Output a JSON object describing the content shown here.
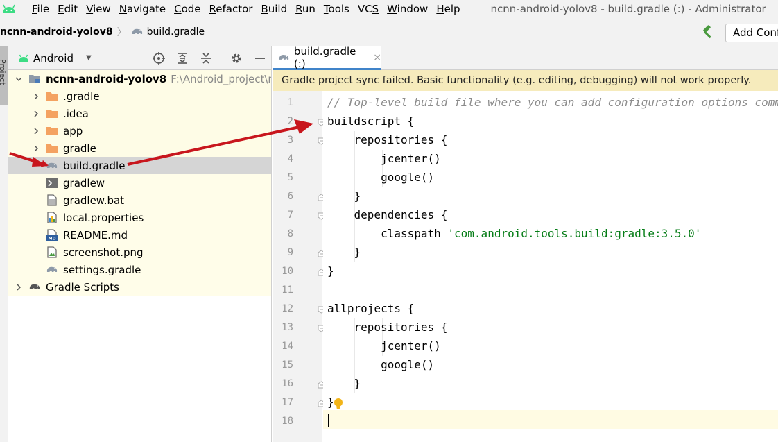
{
  "menubar": {
    "items": [
      {
        "label": "File",
        "u": "F",
        "rest": "ile"
      },
      {
        "label": "Edit",
        "u": "E",
        "rest": "dit"
      },
      {
        "label": "View",
        "u": "V",
        "rest": "iew"
      },
      {
        "label": "Navigate",
        "u": "N",
        "rest": "avigate"
      },
      {
        "label": "Code",
        "u": "C",
        "rest": "ode"
      },
      {
        "label": "Refactor",
        "u": "R",
        "rest": "efactor"
      },
      {
        "label": "Build",
        "u": "B",
        "rest": "uild"
      },
      {
        "label": "Run",
        "u": "R",
        "rest": "un"
      },
      {
        "label": "Tools",
        "u": "T",
        "rest": "ools"
      },
      {
        "label": "VCS",
        "u": "S",
        "pre": "VC",
        "rest": ""
      },
      {
        "label": "Window",
        "u": "W",
        "rest": "indow"
      },
      {
        "label": "Help",
        "u": "H",
        "rest": "elp"
      }
    ],
    "window_title": "ncnn-android-yolov8 - build.gradle (:) - Administrator"
  },
  "navbar": {
    "project": "ncnn-android-yolov8",
    "separator": "〉",
    "file": "build.gradle",
    "run_config_label": "Add Conf"
  },
  "side_strip": {
    "label": "Project"
  },
  "panel": {
    "view_label": "Android",
    "tree": [
      {
        "label": "ncnn-android-yolov8",
        "path": "F:\\Android_project\\ncnn-a",
        "icon": "module-folder-icon",
        "expanded": true,
        "bold": true,
        "level": 0
      },
      {
        "label": ".gradle",
        "icon": "folder-icon",
        "expandable": true,
        "level": 1
      },
      {
        "label": ".idea",
        "icon": "folder-icon",
        "expandable": true,
        "level": 1
      },
      {
        "label": "app",
        "icon": "folder-icon",
        "expandable": true,
        "level": 1
      },
      {
        "label": "gradle",
        "icon": "folder-icon",
        "expandable": true,
        "level": 1
      },
      {
        "label": "build.gradle",
        "icon": "gradle-elephant-icon",
        "selected": true,
        "level": 1
      },
      {
        "label": "gradlew",
        "icon": "terminal-file-icon",
        "level": 1
      },
      {
        "label": "gradlew.bat",
        "icon": "text-file-icon",
        "level": 1
      },
      {
        "label": "local.properties",
        "icon": "properties-file-icon",
        "level": 1
      },
      {
        "label": "README.md",
        "icon": "markdown-file-icon",
        "level": 1
      },
      {
        "label": "screenshot.png",
        "icon": "image-file-icon",
        "level": 1
      },
      {
        "label": "settings.gradle",
        "icon": "gradle-elephant-icon",
        "level": 1
      },
      {
        "label": "Gradle Scripts",
        "icon": "gradle-elephant-dark-icon",
        "expandable": true,
        "level": 0
      }
    ]
  },
  "editor": {
    "tab_label": "build.gradle (:)",
    "tab_close": "×",
    "warning": "Gradle project sync failed. Basic functionality (e.g. editing, debugging) will not work properly.",
    "line_numbers": [
      "1",
      "2",
      "3",
      "4",
      "5",
      "6",
      "7",
      "8",
      "9",
      "10",
      "11",
      "12",
      "13",
      "14",
      "15",
      "16",
      "17",
      "18"
    ],
    "lines": [
      {
        "indent": "",
        "comment": "// Top-level build file where you can add configuration options common to all sub-projects/modules."
      },
      {
        "indent": "",
        "code": "buildscript {"
      },
      {
        "indent": "    ",
        "code": "repositories {"
      },
      {
        "indent": "        ",
        "code": "jcenter()"
      },
      {
        "indent": "        ",
        "code": "google()"
      },
      {
        "indent": "    ",
        "code": "}"
      },
      {
        "indent": "    ",
        "code": "dependencies {"
      },
      {
        "indent": "        ",
        "code": "classpath ",
        "string": "'com.android.tools.build:gradle:3.5.0'"
      },
      {
        "indent": "    ",
        "code": "}"
      },
      {
        "indent": "",
        "code": "}"
      },
      {
        "indent": "",
        "code": ""
      },
      {
        "indent": "",
        "code": "allprojects {"
      },
      {
        "indent": "    ",
        "code": "repositories {"
      },
      {
        "indent": "        ",
        "code": "jcenter()"
      },
      {
        "indent": "        ",
        "code": "google()"
      },
      {
        "indent": "    ",
        "code": "}"
      },
      {
        "indent": "",
        "code": "}"
      },
      {
        "indent": "",
        "code": ""
      }
    ]
  },
  "colors": {
    "accent_tab": "#4083c9",
    "warning_bg": "#f6ebbc",
    "string": "#067d17",
    "comment": "#8c8c8c",
    "annotation_arrow": "#c8161d",
    "folder": "#f4a261",
    "android_green": "#3ddc84"
  }
}
